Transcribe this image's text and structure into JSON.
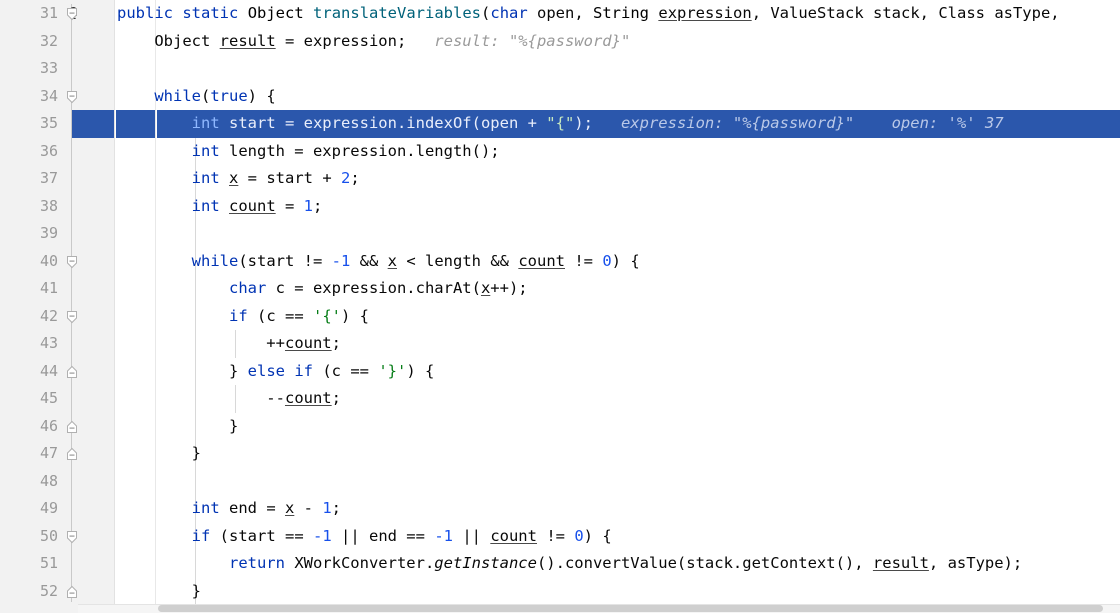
{
  "editor": {
    "language": "java",
    "colors": {
      "background": "#ffffff",
      "gutter_background": "#f2f2f2",
      "line_number": "#999999",
      "selection_highlight": "#2b57ac",
      "keyword": "#0033b3",
      "number": "#1750eb",
      "string": "#067d17",
      "method": "#00627a",
      "inlay_hint": "#9a9a9a",
      "indent_guide": "#d8d8d8",
      "scrollbar_thumb": "#cfcfcf"
    },
    "highlighted_line": 35,
    "annotation_gutter_symbol": "@",
    "lines": [
      {
        "number": "31",
        "annotation": "@",
        "fold": "open",
        "indent_guides": [],
        "tokens": [
          {
            "t": "public",
            "c": "kw"
          },
          {
            "t": " ",
            "c": ""
          },
          {
            "t": "static",
            "c": "kw"
          },
          {
            "t": " ",
            "c": ""
          },
          {
            "t": "Object",
            "c": "cls"
          },
          {
            "t": " ",
            "c": ""
          },
          {
            "t": "translateVariables",
            "c": "meth"
          },
          {
            "t": "(",
            "c": ""
          },
          {
            "t": "char",
            "c": "kw"
          },
          {
            "t": " open, ",
            "c": ""
          },
          {
            "t": "String",
            "c": "cls"
          },
          {
            "t": " ",
            "c": ""
          },
          {
            "t": "expression",
            "c": "fld"
          },
          {
            "t": ", ValueStack stack, Class asType,",
            "c": ""
          }
        ]
      },
      {
        "number": "32",
        "annotation": "",
        "fold": "",
        "indent_guides": [],
        "tokens": [
          {
            "t": "    Object ",
            "c": ""
          },
          {
            "t": "result",
            "c": "fld"
          },
          {
            "t": " = expression;",
            "c": ""
          },
          {
            "t": "   result: \"%{password}\"",
            "c": "hint"
          }
        ]
      },
      {
        "number": "33",
        "annotation": "",
        "fold": "",
        "indent_guides": [],
        "tokens": []
      },
      {
        "number": "34",
        "annotation": "",
        "fold": "open",
        "indent_guides": [],
        "tokens": [
          {
            "t": "    ",
            "c": ""
          },
          {
            "t": "while",
            "c": "kw"
          },
          {
            "t": "(",
            "c": ""
          },
          {
            "t": "true",
            "c": "kw"
          },
          {
            "t": ") {",
            "c": ""
          }
        ]
      },
      {
        "number": "35",
        "annotation": "",
        "fold": "",
        "highlighted": true,
        "indent_guides": [],
        "tokens": [
          {
            "t": "        ",
            "c": ""
          },
          {
            "t": "int",
            "c": "kw"
          },
          {
            "t": " start = expression.",
            "c": ""
          },
          {
            "t": "indexOf",
            "c": ""
          },
          {
            "t": "(open + ",
            "c": ""
          },
          {
            "t": "\"{\"",
            "c": "str"
          },
          {
            "t": ");",
            "c": ""
          },
          {
            "t": "   expression: \"%{password}\"    open: '%' 37",
            "c": "hint"
          }
        ]
      },
      {
        "number": "36",
        "annotation": "",
        "fold": "",
        "indent_guides": [
          195
        ],
        "tokens": [
          {
            "t": "        ",
            "c": ""
          },
          {
            "t": "int",
            "c": "kw"
          },
          {
            "t": " length = expression.length();",
            "c": ""
          }
        ]
      },
      {
        "number": "37",
        "annotation": "",
        "fold": "",
        "indent_guides": [
          195
        ],
        "tokens": [
          {
            "t": "        ",
            "c": ""
          },
          {
            "t": "int",
            "c": "kw"
          },
          {
            "t": " ",
            "c": ""
          },
          {
            "t": "x",
            "c": "fld"
          },
          {
            "t": " = start + ",
            "c": ""
          },
          {
            "t": "2",
            "c": "num"
          },
          {
            "t": ";",
            "c": ""
          }
        ]
      },
      {
        "number": "38",
        "annotation": "",
        "fold": "",
        "indent_guides": [
          195
        ],
        "tokens": [
          {
            "t": "        ",
            "c": ""
          },
          {
            "t": "int",
            "c": "kw"
          },
          {
            "t": " ",
            "c": ""
          },
          {
            "t": "count",
            "c": "fld"
          },
          {
            "t": " = ",
            "c": ""
          },
          {
            "t": "1",
            "c": "num"
          },
          {
            "t": ";",
            "c": ""
          }
        ]
      },
      {
        "number": "39",
        "annotation": "",
        "fold": "",
        "indent_guides": [
          195
        ],
        "tokens": []
      },
      {
        "number": "40",
        "annotation": "",
        "fold": "open",
        "indent_guides": [
          195
        ],
        "tokens": [
          {
            "t": "        ",
            "c": ""
          },
          {
            "t": "while",
            "c": "kw"
          },
          {
            "t": "(start != ",
            "c": ""
          },
          {
            "t": "-1",
            "c": "num"
          },
          {
            "t": " && ",
            "c": ""
          },
          {
            "t": "x",
            "c": "fld"
          },
          {
            "t": " < length && ",
            "c": ""
          },
          {
            "t": "count",
            "c": "fld"
          },
          {
            "t": " != ",
            "c": ""
          },
          {
            "t": "0",
            "c": "num"
          },
          {
            "t": ") {",
            "c": ""
          }
        ]
      },
      {
        "number": "41",
        "annotation": "",
        "fold": "",
        "indent_guides": [
          195
        ],
        "tokens": [
          {
            "t": "            ",
            "c": ""
          },
          {
            "t": "char",
            "c": "kw"
          },
          {
            "t": " c = expression.charAt(",
            "c": ""
          },
          {
            "t": "x",
            "c": "fld"
          },
          {
            "t": "++);",
            "c": ""
          }
        ]
      },
      {
        "number": "42",
        "annotation": "",
        "fold": "open",
        "indent_guides": [
          195
        ],
        "tokens": [
          {
            "t": "            ",
            "c": ""
          },
          {
            "t": "if",
            "c": "kw"
          },
          {
            "t": " (c == ",
            "c": ""
          },
          {
            "t": "'{'",
            "c": "str"
          },
          {
            "t": ") {",
            "c": ""
          }
        ]
      },
      {
        "number": "43",
        "annotation": "",
        "fold": "",
        "indent_guides": [
          195,
          235
        ],
        "tokens": [
          {
            "t": "                ++",
            "c": ""
          },
          {
            "t": "count",
            "c": "fld"
          },
          {
            "t": ";",
            "c": ""
          }
        ]
      },
      {
        "number": "44",
        "annotation": "",
        "fold": "close",
        "indent_guides": [
          195
        ],
        "tokens": [
          {
            "t": "            } ",
            "c": ""
          },
          {
            "t": "else",
            "c": "kw"
          },
          {
            "t": " ",
            "c": ""
          },
          {
            "t": "if",
            "c": "kw"
          },
          {
            "t": " (c == ",
            "c": ""
          },
          {
            "t": "'}'",
            "c": "str"
          },
          {
            "t": ") {",
            "c": ""
          }
        ]
      },
      {
        "number": "45",
        "annotation": "",
        "fold": "",
        "indent_guides": [
          195,
          235
        ],
        "tokens": [
          {
            "t": "                --",
            "c": ""
          },
          {
            "t": "count",
            "c": "fld"
          },
          {
            "t": ";",
            "c": ""
          }
        ]
      },
      {
        "number": "46",
        "annotation": "",
        "fold": "close",
        "indent_guides": [
          195
        ],
        "tokens": [
          {
            "t": "            }",
            "c": ""
          }
        ]
      },
      {
        "number": "47",
        "annotation": "",
        "fold": "close",
        "indent_guides": [
          195
        ],
        "tokens": [
          {
            "t": "        }",
            "c": ""
          }
        ]
      },
      {
        "number": "48",
        "annotation": "",
        "fold": "",
        "indent_guides": [
          195
        ],
        "tokens": []
      },
      {
        "number": "49",
        "annotation": "",
        "fold": "",
        "indent_guides": [
          195
        ],
        "tokens": [
          {
            "t": "        ",
            "c": ""
          },
          {
            "t": "int",
            "c": "kw"
          },
          {
            "t": " end = ",
            "c": ""
          },
          {
            "t": "x",
            "c": "fld"
          },
          {
            "t": " - ",
            "c": ""
          },
          {
            "t": "1",
            "c": "num"
          },
          {
            "t": ";",
            "c": ""
          }
        ]
      },
      {
        "number": "50",
        "annotation": "",
        "fold": "open",
        "indent_guides": [
          195
        ],
        "tokens": [
          {
            "t": "        ",
            "c": ""
          },
          {
            "t": "if",
            "c": "kw"
          },
          {
            "t": " (start == ",
            "c": ""
          },
          {
            "t": "-1",
            "c": "num"
          },
          {
            "t": " || end == ",
            "c": ""
          },
          {
            "t": "-1",
            "c": "num"
          },
          {
            "t": " || ",
            "c": ""
          },
          {
            "t": "count",
            "c": "fld"
          },
          {
            "t": " != ",
            "c": ""
          },
          {
            "t": "0",
            "c": "num"
          },
          {
            "t": ") {",
            "c": ""
          }
        ]
      },
      {
        "number": "51",
        "annotation": "",
        "fold": "",
        "indent_guides": [
          195
        ],
        "tokens": [
          {
            "t": "            ",
            "c": ""
          },
          {
            "t": "return",
            "c": "kw"
          },
          {
            "t": " XWorkConverter.",
            "c": ""
          },
          {
            "t": "getInstance",
            "c": "stat"
          },
          {
            "t": "().convertValue(stack.getContext(), ",
            "c": ""
          },
          {
            "t": "result",
            "c": "fld"
          },
          {
            "t": ", asType);",
            "c": ""
          }
        ]
      },
      {
        "number": "52",
        "annotation": "",
        "fold": "close",
        "indent_guides": [
          195
        ],
        "tokens": [
          {
            "t": "        }",
            "c": ""
          }
        ]
      }
    ]
  },
  "scrollbar": {
    "orientation": "horizontal",
    "position": "bottom"
  }
}
